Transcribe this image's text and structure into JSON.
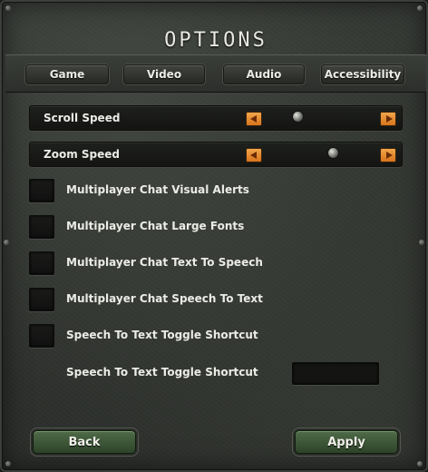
{
  "window": {
    "title": "Options"
  },
  "tabs": [
    {
      "label": "Game"
    },
    {
      "label": "Video"
    },
    {
      "label": "Audio"
    },
    {
      "label": "Accessibility"
    }
  ],
  "sliders": [
    {
      "label": "Scroll Speed",
      "value": 0.31
    },
    {
      "label": "Zoom Speed",
      "value": 0.63
    }
  ],
  "checkboxes": [
    {
      "label": "Multiplayer Chat Visual Alerts",
      "checked": false
    },
    {
      "label": "Multiplayer Chat Large Fonts",
      "checked": false
    },
    {
      "label": "Multiplayer Chat Text To Speech",
      "checked": false
    },
    {
      "label": "Multiplayer Chat Speech To Text",
      "checked": false
    },
    {
      "label": "Speech To Text Toggle Shortcut",
      "checked": false
    }
  ],
  "shortcut": {
    "label": "Speech To Text Toggle Shortcut",
    "value": ""
  },
  "buttons": {
    "back": "Back",
    "apply": "Apply"
  },
  "colors": {
    "accent_orange": "#e88a2c",
    "button_green": "#3f5a39",
    "panel": "#2f322e"
  }
}
